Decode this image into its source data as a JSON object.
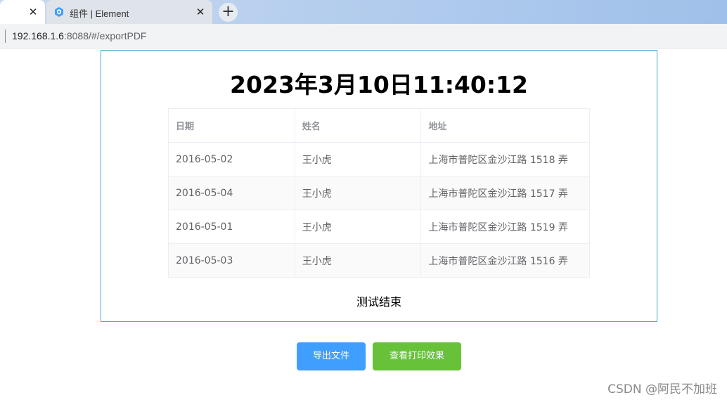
{
  "browser": {
    "tabs": [
      {
        "label": "",
        "close": "✕",
        "active": true
      },
      {
        "label": "组件 | Element",
        "close": "✕",
        "active": false
      }
    ],
    "new_tab": "+",
    "url_host": "192.168.1.6",
    "url_rest": ":8088/#/exportPDF"
  },
  "print": {
    "clock": "2023年3月10日11:40:12",
    "table": {
      "headers": [
        "日期",
        "姓名",
        "地址"
      ],
      "rows": [
        [
          "2016-05-02",
          "王小虎",
          "上海市普陀区金沙江路 1518 弄"
        ],
        [
          "2016-05-04",
          "王小虎",
          "上海市普陀区金沙江路 1517 弄"
        ],
        [
          "2016-05-01",
          "王小虎",
          "上海市普陀区金沙江路 1519 弄"
        ],
        [
          "2016-05-03",
          "王小虎",
          "上海市普陀区金沙江路 1516 弄"
        ]
      ]
    },
    "footer": "测试结束"
  },
  "actions": {
    "export": "导出文件",
    "preview": "查看打印效果"
  },
  "watermark": "CSDN @阿民不加班",
  "colors": {
    "primary": "#409eff",
    "success": "#67c23a",
    "print_border": "#46a6c6"
  }
}
